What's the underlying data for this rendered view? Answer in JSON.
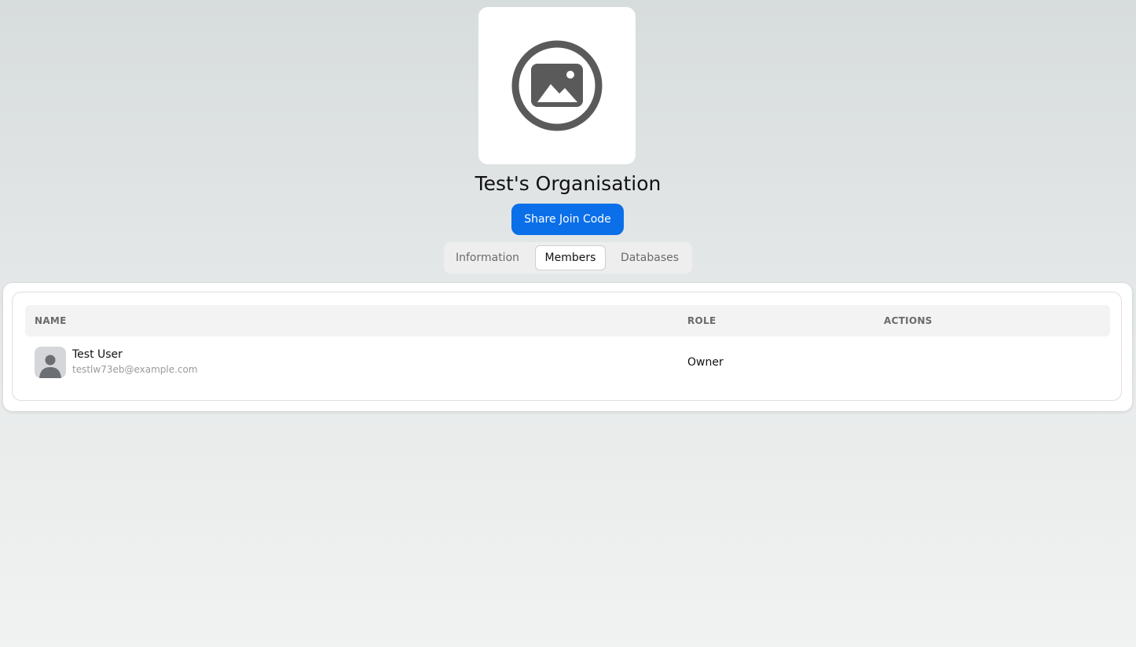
{
  "organisation": {
    "image_icon": "image-placeholder-icon",
    "title": "Test's Organisation",
    "share_label": "Share Join Code"
  },
  "tabs": [
    {
      "label": "Information",
      "active": false
    },
    {
      "label": "Members",
      "active": true
    },
    {
      "label": "Databases",
      "active": false
    }
  ],
  "members_table": {
    "headers": {
      "name": "NAME",
      "role": "ROLE",
      "actions": "ACTIONS"
    },
    "rows": [
      {
        "avatar_icon": "user-avatar-icon",
        "name": "Test User",
        "email": "testlw73eb@example.com",
        "role": "Owner",
        "actions": ""
      }
    ]
  },
  "colors": {
    "accent": "#0a6fe8",
    "icon": "#5a5a5a"
  }
}
